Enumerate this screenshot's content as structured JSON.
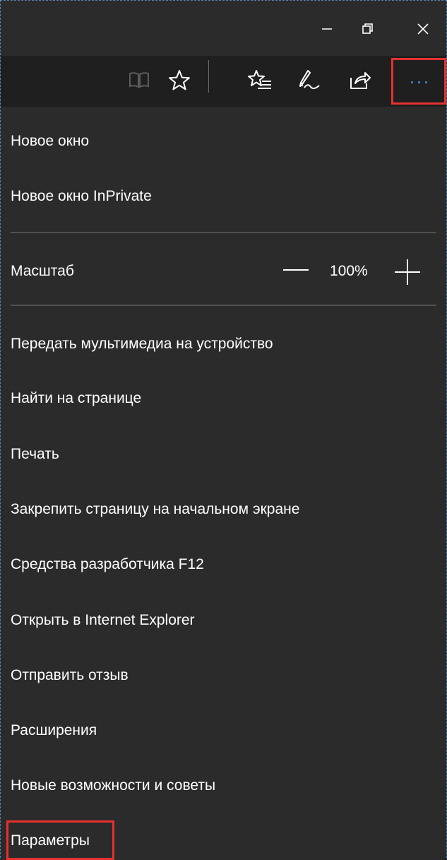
{
  "titlebar": {
    "minimize_icon": "minimize-icon",
    "restore_icon": "restore-icon",
    "close_icon": "close-icon"
  },
  "toolbar": {
    "icons": [
      "reading-view-icon",
      "favorite-star-icon",
      "favorites-hub-icon",
      "web-note-icon",
      "share-icon",
      "more-actions-icon"
    ],
    "highlight_color": "#e5312f",
    "more_dots_color": "#3c8ce0"
  },
  "menu": {
    "new_window": "Новое окно",
    "new_inprivate": "Новое окно InPrivate",
    "zoom_label": "Масштаб",
    "zoom_value": "100%",
    "cast_media": "Передать мультимедиа на устройство",
    "find_on_page": "Найти на странице",
    "print": "Печать",
    "pin_to_start": "Закрепить страницу на начальном экране",
    "dev_tools": "Средства разработчика F12",
    "open_ie": "Открыть в Internet Explorer",
    "send_feedback": "Отправить отзыв",
    "extensions": "Расширения",
    "whats_new": "Новые возможности и советы",
    "settings": "Параметры"
  },
  "colors": {
    "background": "#2b2b2b",
    "toolbar": "#1f1f1f",
    "divider": "#505050",
    "text": "#ffffff"
  }
}
